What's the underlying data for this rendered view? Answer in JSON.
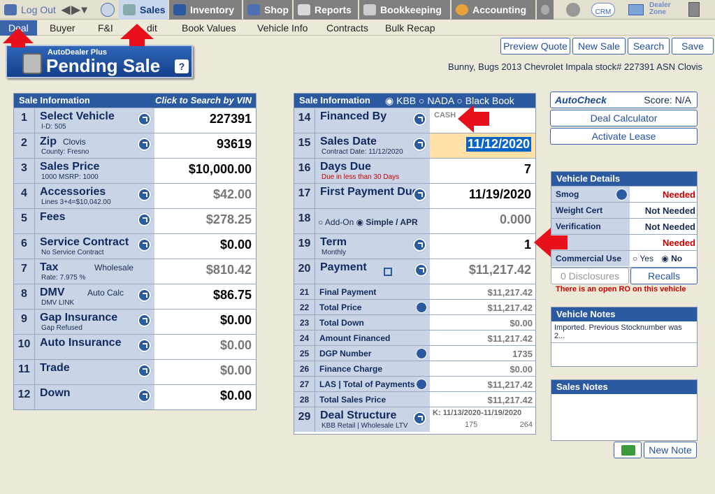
{
  "topnav": {
    "logout": "Log Out",
    "sales": "Sales",
    "inventory": "Inventory",
    "shop": "Shop",
    "reports": "Reports",
    "bookkeeping": "Bookkeeping",
    "accounting": "Accounting",
    "crm": "CRM",
    "dealer_zone_1": "Dealer",
    "dealer_zone_2": "Zone"
  },
  "subnav": {
    "deal": "Deal",
    "buyer": "Buyer",
    "fi": "F&I",
    "edit": "dit",
    "book_values": "Book Values",
    "vehicle_info": "Vehicle Info",
    "contracts": "Contracts",
    "bulk_recap": "Bulk Recap"
  },
  "banner": {
    "small": "AutoDealer Plus",
    "title": "Pending Sale",
    "help": "?"
  },
  "toolbar": {
    "preview": "Preview Quote",
    "new_sale": "New Sale",
    "search": "Search",
    "save": "Save"
  },
  "customer_line": "Bunny,  Bugs   2013 Chevrolet Impala   stock# 227391  ASN Clovis",
  "left": {
    "header": "Sale Information",
    "header_right": "Click to Search by VIN",
    "rows": [
      {
        "num": "1",
        "name": "Select Vehicle",
        "sub": "I-D:  505",
        "value": "227391"
      },
      {
        "num": "2",
        "name": "Zip",
        "extra": "Clovis",
        "sub": "County: Fresno",
        "value": "93619"
      },
      {
        "num": "3",
        "name": "Sales Price",
        "sub": "1000 MSRP: 1000",
        "value": "$10,000.00"
      },
      {
        "num": "4",
        "name": "Accessories",
        "sub": "Lines 3+4=$10,042.00",
        "value": "$42.00"
      },
      {
        "num": "5",
        "name": "Fees",
        "sub": "",
        "value": "$278.25"
      },
      {
        "num": "6",
        "name": "Service Contract",
        "sub": "No Service Contract",
        "value": "$0.00"
      },
      {
        "num": "7",
        "name": "Tax",
        "extra": "Wholesale",
        "sub": "Rate: 7.975 %",
        "value": "$810.42"
      },
      {
        "num": "8",
        "name": "DMV",
        "extra": "Auto Calc",
        "sub": "DMV LINK",
        "value": "$86.75"
      },
      {
        "num": "9",
        "name": "Gap Insurance",
        "sub": "Gap Refused",
        "value": "$0.00"
      },
      {
        "num": "10",
        "name": "Auto Insurance",
        "sub": "",
        "value": "$0.00"
      },
      {
        "num": "11",
        "name": "Trade",
        "sub": "",
        "value": "$0.00"
      },
      {
        "num": "12",
        "name": "Down",
        "sub": "",
        "value": "$0.00"
      }
    ]
  },
  "mid": {
    "header": "Sale Information",
    "kbb": "KBB",
    "nada": "NADA",
    "bb": "Black Book",
    "rows": [
      {
        "num": "14",
        "name": "Financed By",
        "sub": "",
        "value": "CASH"
      },
      {
        "num": "15",
        "name": "Sales Date",
        "sub": "Contract Date:  11/12/2020",
        "value": "11/12/2020"
      },
      {
        "num": "16",
        "name": "Days Due",
        "sub": "Due in less than 30 Days",
        "value": "7"
      },
      {
        "num": "17",
        "name": "First Payment Due",
        "sub": "",
        "value": "11/19/2020"
      },
      {
        "num": "18",
        "name": "",
        "addon": "Add-On",
        "simple": "Simple / APR",
        "value": "0.000"
      },
      {
        "num": "19",
        "name": "Term",
        "sub": "Monthly",
        "value": "1"
      },
      {
        "num": "20",
        "name": "Payment",
        "sub": "",
        "value": "$11,217.42"
      }
    ],
    "small": [
      {
        "num": "21",
        "name": "Final Payment",
        "value": "$11,217.42"
      },
      {
        "num": "22",
        "name": "Total Price",
        "value": "$11,217.42"
      },
      {
        "num": "23",
        "name": "Total Down",
        "value": "$0.00"
      },
      {
        "num": "24",
        "name": "Amount Financed",
        "value": "$11,217.42"
      },
      {
        "num": "25",
        "name": "DGP Number",
        "value": "1735"
      },
      {
        "num": "26",
        "name": "Finance Charge",
        "value": "$0.00"
      },
      {
        "num": "27",
        "name": "LAS | Total of Payments",
        "value": "$11,217.42"
      },
      {
        "num": "28",
        "name": "Total Sales Price",
        "value": "$11,217.42"
      }
    ],
    "deal": {
      "num": "29",
      "name": "Deal Structure",
      "sub": "KBB Retail | Wholesale LTV",
      "k": "K: 11/13/2020-11/19/2020",
      "a": "175",
      "b": "264"
    }
  },
  "right": {
    "autocheck": "AutoCheck",
    "score": "Score:  N/A",
    "deal_calc": "Deal Calculator",
    "activate_lease": "Activate Lease",
    "vd_header": "Vehicle Details",
    "vd": [
      {
        "k": "Smog",
        "v": "Needed",
        "red": true
      },
      {
        "k": "Weight Cert",
        "v": "Not Needed",
        "red": false
      },
      {
        "k": "Verification",
        "v": "Not Needed",
        "red": false
      },
      {
        "k": "e",
        "v": "Needed",
        "red": true
      }
    ],
    "commercial": "Commercial Use",
    "yes": "Yes",
    "no": "No",
    "disclosures": "0 Disclosures",
    "recalls": "Recalls",
    "open_ro": "There is an open RO on this vehicle",
    "vn_header": "Vehicle Notes",
    "vn_text": "Imported.  Previous Stocknumber was 2...",
    "sn_header": "Sales Notes",
    "new_note": "New Note"
  }
}
